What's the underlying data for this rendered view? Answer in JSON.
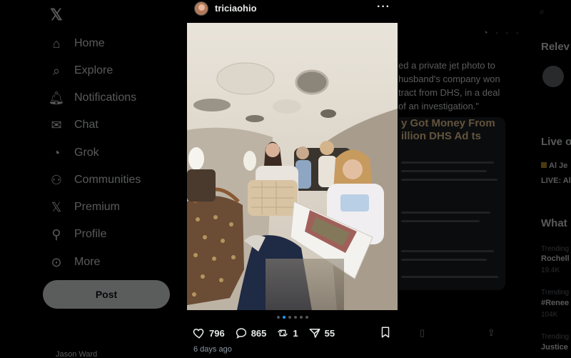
{
  "sidebar": {
    "items": [
      {
        "label": "Home",
        "icon": "home-icon"
      },
      {
        "label": "Explore",
        "icon": "search-icon"
      },
      {
        "label": "Notifications",
        "icon": "bell-icon"
      },
      {
        "label": "Chat",
        "icon": "mail-icon"
      },
      {
        "label": "Grok",
        "icon": "grok-icon"
      },
      {
        "label": "Communities",
        "icon": "people-icon"
      },
      {
        "label": "Premium",
        "icon": "x-icon"
      },
      {
        "label": "Profile",
        "icon": "person-icon"
      },
      {
        "label": "More",
        "icon": "more-circle-icon"
      }
    ],
    "post_label": "Post",
    "account_label": "Jason Ward"
  },
  "background_tweet": {
    "text": "ed a private jet photo to husband's company won tract from DHS, in a deal of an investigation.\"",
    "card_headline": "y Got Money From illion DHS Ad ts"
  },
  "right_col": {
    "relevant_title": "Relev",
    "live_title": "Live o",
    "live_line1": "Al Je",
    "live_line2": "LIVE: Al",
    "whats_title": "What",
    "trend1_small": "Trending",
    "trend1_name": "Rochell",
    "trend1_count": "19.4K",
    "trend2_small": "Trending",
    "trend2_name": "#Renee",
    "trend2_count": "104K",
    "trend3_small": "Trending",
    "trend3_name": "Justice"
  },
  "modal": {
    "username": "triciaohio",
    "more_label": "···",
    "carousel": {
      "total": 6,
      "active": 1
    },
    "stats": {
      "likes": "796",
      "replies": "865",
      "reposts": "1",
      "views": "55"
    },
    "timestamp": "6 days ago"
  },
  "colors": {
    "accent": "#1d9bf0",
    "background": "#000000",
    "text": "#e7e9ea",
    "muted": "#8b98a5"
  }
}
